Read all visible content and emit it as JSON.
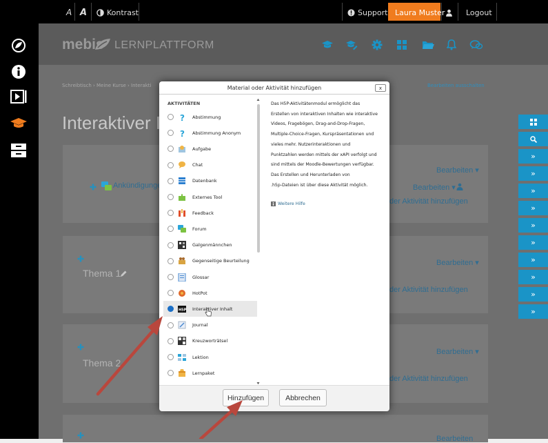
{
  "topbar": {
    "font_small": "A",
    "font_large": "A",
    "contrast_label": "Kontrast",
    "support_label": "Support",
    "user_name": "Laura Muster",
    "logout_label": "Logout"
  },
  "header": {
    "brand_mebis": "mebis",
    "brand_lernplattform": "LERNPLATTFORM"
  },
  "breadcrumb": {
    "text": "Schreibtisch › Meine Kurse › Interakti",
    "edit_link": "Bearbeiten ausschalten"
  },
  "page": {
    "title": "Interaktiver In"
  },
  "sections": {
    "announcement_label": "Ankündigunge",
    "edit_label": "Bearbeiten",
    "add_activity_label": "der Aktivität hinzufügen",
    "topic1": "Thema 1",
    "topic2": "Thema 2"
  },
  "dialog": {
    "title": "Material oder Aktivität hinzufügen",
    "close": "x",
    "category": "AKTIVITÄTEN",
    "items": [
      {
        "label": "Abstimmung",
        "icon": "question-icon"
      },
      {
        "label": "Abstimmung Anonym",
        "icon": "question-icon"
      },
      {
        "label": "Aufgabe",
        "icon": "assignment-icon"
      },
      {
        "label": "Chat",
        "icon": "chat-icon"
      },
      {
        "label": "Datenbank",
        "icon": "database-icon"
      },
      {
        "label": "Externes Tool",
        "icon": "puzzle-icon"
      },
      {
        "label": "Feedback",
        "icon": "megaphone-icon"
      },
      {
        "label": "Forum",
        "icon": "forum-icon"
      },
      {
        "label": "Galgenmännchen",
        "icon": "hangman-icon"
      },
      {
        "label": "Gegenseitige Beurteilung",
        "icon": "workshop-icon"
      },
      {
        "label": "Glossar",
        "icon": "glossary-icon"
      },
      {
        "label": "HotPot",
        "icon": "hotpot-icon"
      },
      {
        "label": "Interaktiver Inhalt",
        "icon": "h5p-icon"
      },
      {
        "label": "Journal",
        "icon": "journal-icon"
      },
      {
        "label": "Kreuzworträtsel",
        "icon": "crossword-icon"
      },
      {
        "label": "Lektion",
        "icon": "lesson-icon"
      },
      {
        "label": "Lernpaket",
        "icon": "package-icon"
      }
    ],
    "selected_index": 12,
    "description": [
      "Das H5P-Aktivitätenmodul ermöglicht das",
      "Erstellen von interaktiven Inhalten wie interaktive",
      "Videos, Fragebögen, Drag-and-Drop-Fragen,",
      "Multiple-Choice-Fragen, Kurspräsentationen und",
      "vieles mehr. Nutzerinteraktionen und",
      "Punktzahlen werden mittels der xAPI verfolgt und",
      "sind mittels der Moodle-Bewertungen verfügbar.",
      "Das Erstellen und Herunterladen von",
      ".h5p-Dateien ist über diese Aktivität möglich."
    ],
    "more_help": "Weitere Hilfe",
    "add_button": "Hinzufügen",
    "cancel_button": "Abbrechen"
  },
  "colors": {
    "accent_blue": "#1a94c7",
    "user_orange": "#f07c1e",
    "arrow_red": "#b9473d"
  }
}
